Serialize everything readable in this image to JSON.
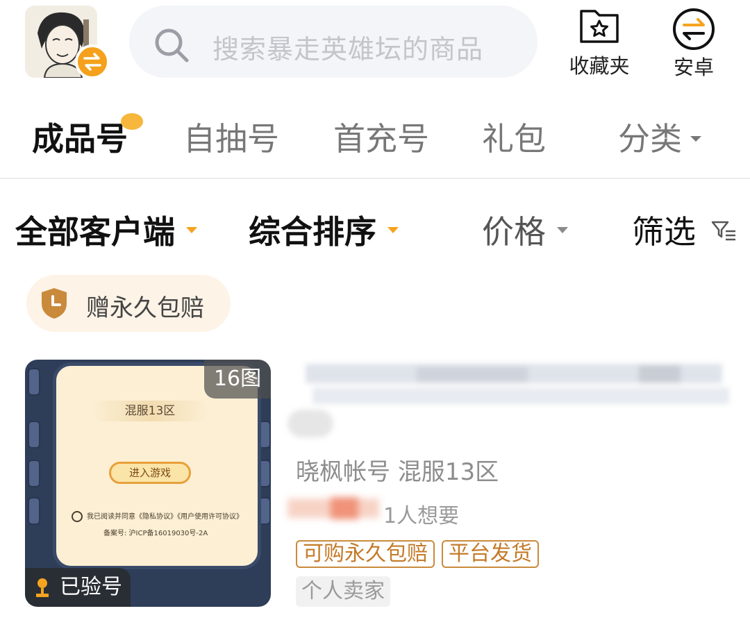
{
  "header": {
    "search_placeholder": "搜索暴走英雄坛的商品",
    "favorites_label": "收藏夹",
    "platform_label": "安卓"
  },
  "tabs": [
    {
      "label": "成品号",
      "active": true
    },
    {
      "label": "自抽号",
      "active": false
    },
    {
      "label": "首充号",
      "active": false
    },
    {
      "label": "礼包",
      "active": false
    },
    {
      "label": "分类",
      "active": false
    }
  ],
  "filters": {
    "client": "全部客户端",
    "sort": "综合排序",
    "price": "价格",
    "screen": "筛选"
  },
  "chip": {
    "label": "赠永久包赔"
  },
  "product": {
    "image_count": "16图",
    "verified_label": "已验号",
    "screenshot": {
      "server": "混服13区",
      "enter_button": "进入游戏",
      "agreement": "我已阅读并同意《隐私协议》《用户使用许可协议》",
      "icp": "备案号: 沪ICP备16019030号-2A"
    },
    "game_line": "晓枫帐号 混服13区",
    "want_count": "1人想要",
    "tags": [
      "可购永久包赔",
      "平台发货"
    ],
    "seller_type": "个人卖家"
  },
  "colors": {
    "accent": "#f6a31f",
    "tag_border": "#c98a3c",
    "chip_bg": "#fdf3e7"
  }
}
